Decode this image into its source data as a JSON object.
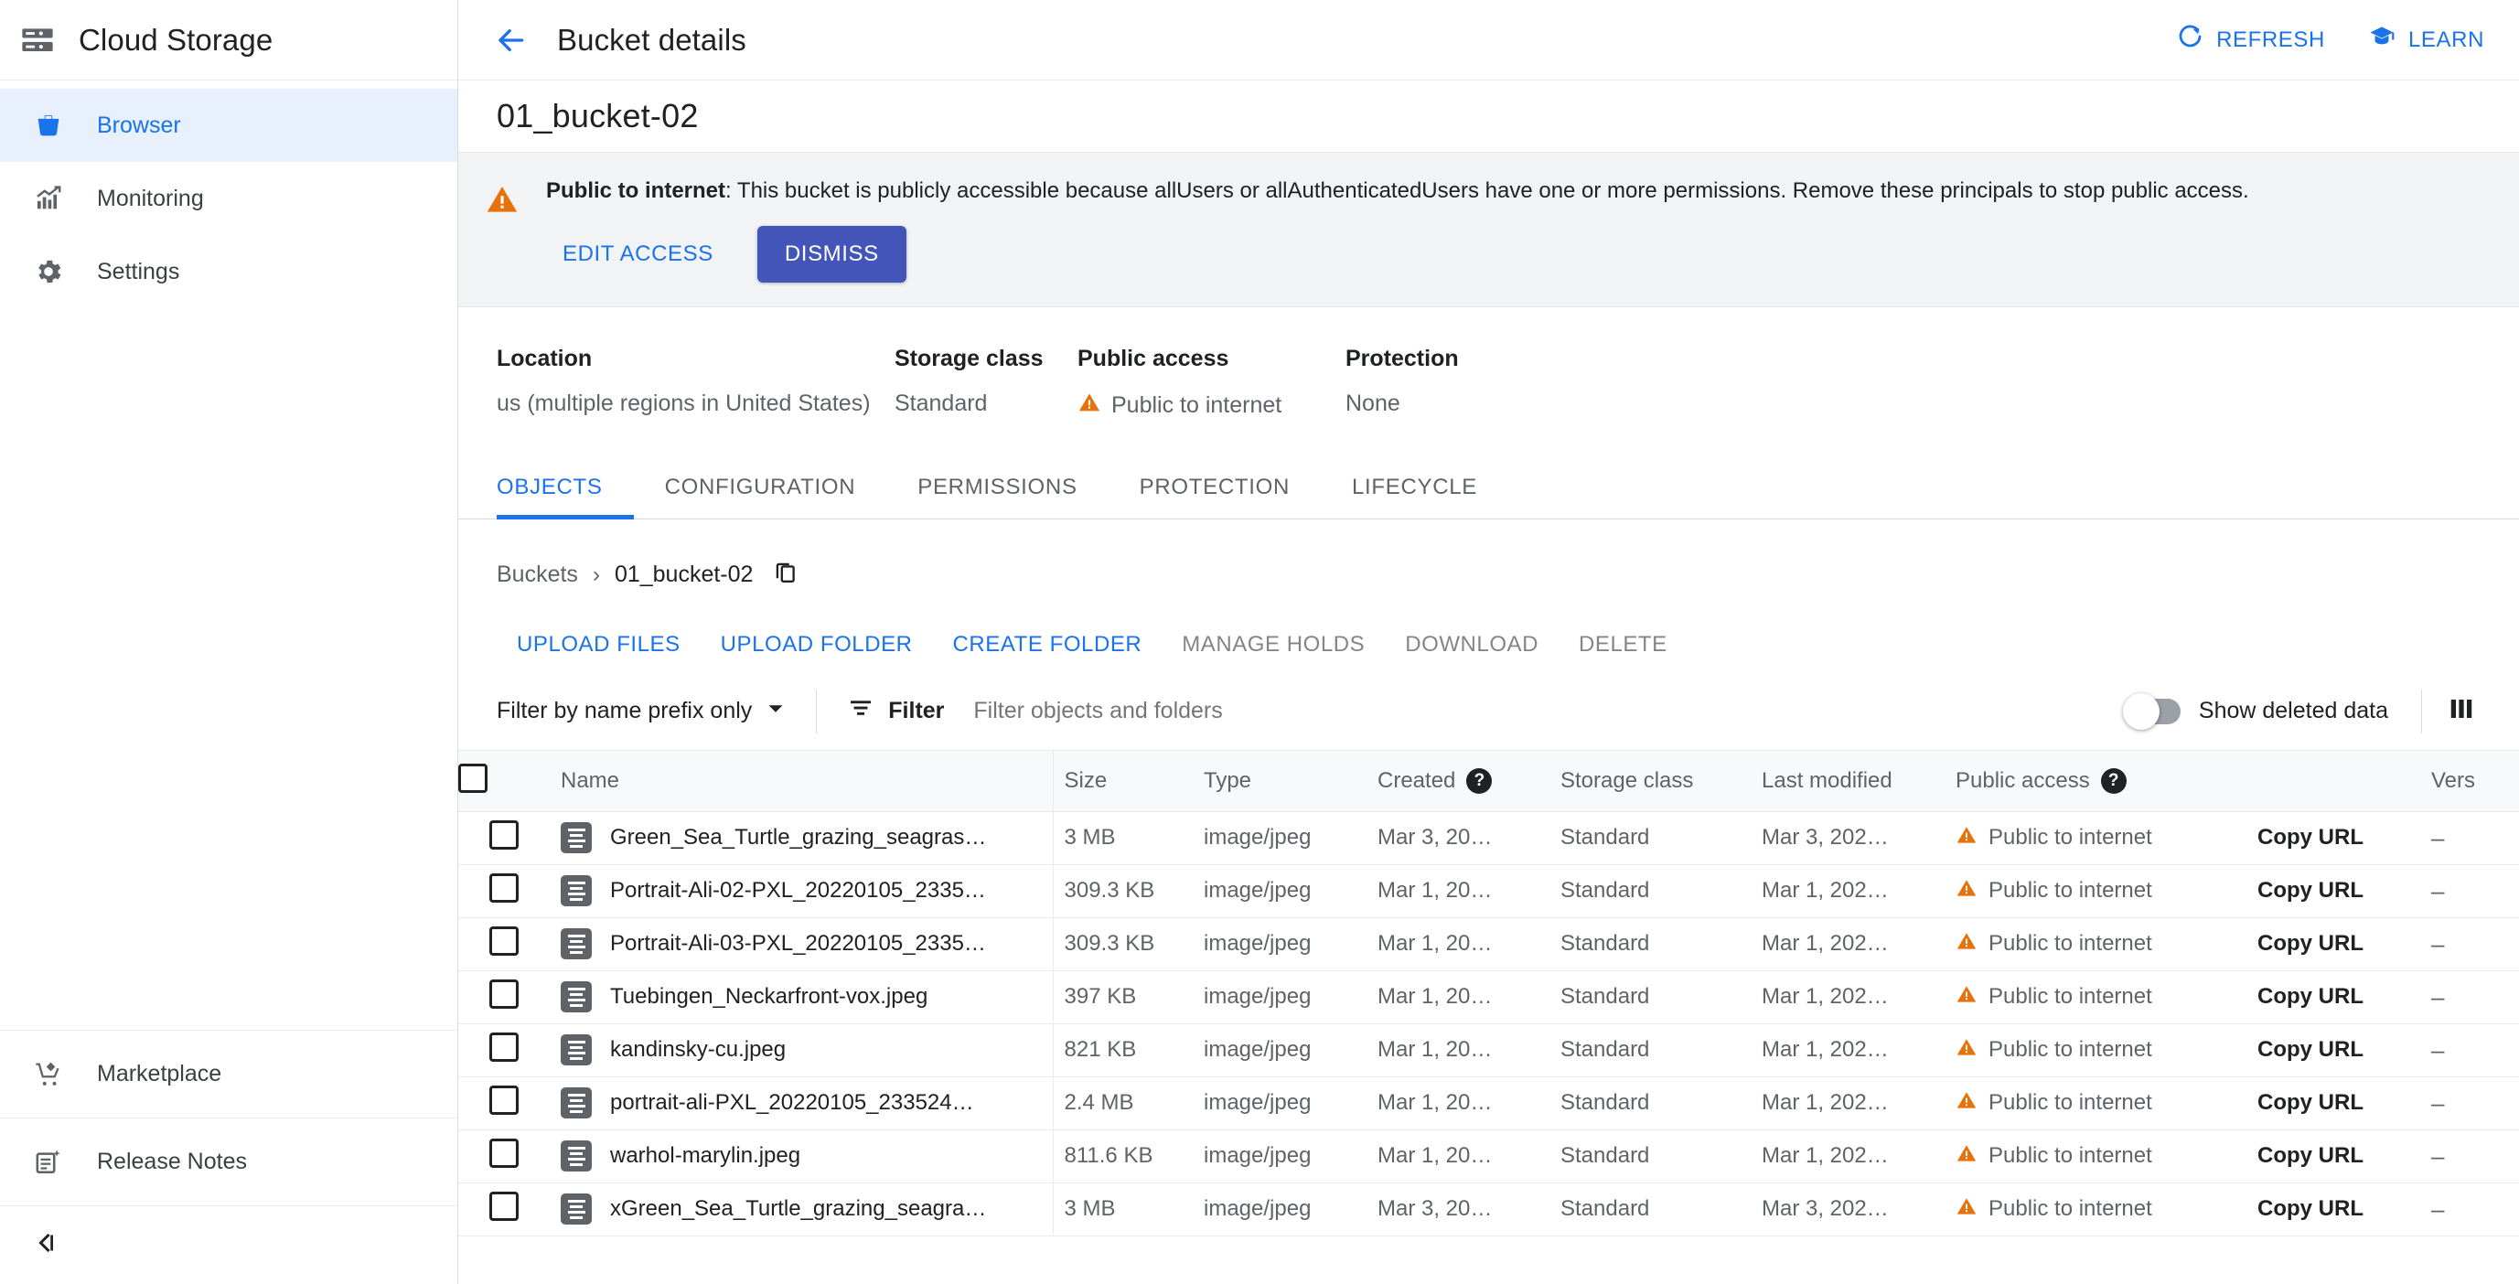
{
  "sidebar": {
    "brand": "Cloud Storage",
    "items": [
      {
        "label": "Browser",
        "icon": "bucket-icon",
        "active": true
      },
      {
        "label": "Monitoring",
        "icon": "chart-icon",
        "active": false
      },
      {
        "label": "Settings",
        "icon": "gear-icon",
        "active": false
      }
    ],
    "bottom_items": [
      {
        "label": "Marketplace",
        "icon": "cart-icon"
      },
      {
        "label": "Release Notes",
        "icon": "notes-icon"
      }
    ],
    "collapse_label": "collapse-panel"
  },
  "topbar": {
    "back_label": "back-arrow",
    "title": "Bucket details",
    "refresh_label": "REFRESH",
    "learn_label": "LEARN"
  },
  "bucket": {
    "name": "01_bucket-02"
  },
  "banner": {
    "strong": "Public to internet",
    "text": ": This bucket is publicly accessible because allUsers or allAuthenticatedUsers have one or more permissions. Remove these principals to stop public access.",
    "edit_access_label": "EDIT ACCESS",
    "dismiss_label": "DISMISS",
    "warning_color": "#e8710a"
  },
  "meta": [
    {
      "label": "Location",
      "value": "us (multiple regions in United States)",
      "warn": false
    },
    {
      "label": "Storage class",
      "value": "Standard",
      "warn": false
    },
    {
      "label": "Public access",
      "value": "Public to internet",
      "warn": true
    },
    {
      "label": "Protection",
      "value": "None",
      "warn": false
    }
  ],
  "tabs": [
    {
      "label": "OBJECTS",
      "active": true
    },
    {
      "label": "CONFIGURATION",
      "active": false
    },
    {
      "label": "PERMISSIONS",
      "active": false
    },
    {
      "label": "PROTECTION",
      "active": false
    },
    {
      "label": "LIFECYCLE",
      "active": false
    }
  ],
  "breadcrumb": {
    "root": "Buckets",
    "separator": "›",
    "current": "01_bucket-02",
    "copy_icon": "copy-icon"
  },
  "object_actions": [
    {
      "label": "UPLOAD FILES",
      "enabled": true
    },
    {
      "label": "UPLOAD FOLDER",
      "enabled": true
    },
    {
      "label": "CREATE FOLDER",
      "enabled": true
    },
    {
      "label": "MANAGE HOLDS",
      "enabled": false
    },
    {
      "label": "DOWNLOAD",
      "enabled": false
    },
    {
      "label": "DELETE",
      "enabled": false
    }
  ],
  "filterbar": {
    "prefix_select": "Filter by name prefix only",
    "filter_label": "Filter",
    "filter_placeholder": "Filter objects and folders",
    "show_deleted_label": "Show deleted data",
    "show_deleted_on": false,
    "columns_icon": "columns-icon"
  },
  "table": {
    "headers": {
      "name": "Name",
      "size": "Size",
      "type": "Type",
      "created": "Created",
      "storage_class": "Storage class",
      "last_modified": "Last modified",
      "public_access": "Public access",
      "versioning": "Vers"
    },
    "copy_url_label": "Copy URL",
    "versioning_value": "–",
    "rows": [
      {
        "name": "Green_Sea_Turtle_grazing_seagras…",
        "size": "3 MB",
        "type": "image/jpeg",
        "created": "Mar 3, 20…",
        "storage_class": "Standard",
        "last_modified": "Mar 3, 202…",
        "public_access": "Public to internet"
      },
      {
        "name": "Portrait-Ali-02-PXL_20220105_2335…",
        "size": "309.3 KB",
        "type": "image/jpeg",
        "created": "Mar 1, 20…",
        "storage_class": "Standard",
        "last_modified": "Mar 1, 202…",
        "public_access": "Public to internet"
      },
      {
        "name": "Portrait-Ali-03-PXL_20220105_2335…",
        "size": "309.3 KB",
        "type": "image/jpeg",
        "created": "Mar 1, 20…",
        "storage_class": "Standard",
        "last_modified": "Mar 1, 202…",
        "public_access": "Public to internet"
      },
      {
        "name": "Tuebingen_Neckarfront-vox.jpeg",
        "size": "397 KB",
        "type": "image/jpeg",
        "created": "Mar 1, 20…",
        "storage_class": "Standard",
        "last_modified": "Mar 1, 202…",
        "public_access": "Public to internet"
      },
      {
        "name": "kandinsky-cu.jpeg",
        "size": "821 KB",
        "type": "image/jpeg",
        "created": "Mar 1, 20…",
        "storage_class": "Standard",
        "last_modified": "Mar 1, 202…",
        "public_access": "Public to internet"
      },
      {
        "name": "portrait-ali-PXL_20220105_233524…",
        "size": "2.4 MB",
        "type": "image/jpeg",
        "created": "Mar 1, 20…",
        "storage_class": "Standard",
        "last_modified": "Mar 1, 202…",
        "public_access": "Public to internet"
      },
      {
        "name": "warhol-marylin.jpeg",
        "size": "811.6 KB",
        "type": "image/jpeg",
        "created": "Mar 1, 20…",
        "storage_class": "Standard",
        "last_modified": "Mar 1, 202…",
        "public_access": "Public to internet"
      },
      {
        "name": "xGreen_Sea_Turtle_grazing_seagra…",
        "size": "3 MB",
        "type": "image/jpeg",
        "created": "Mar 3, 20…",
        "storage_class": "Standard",
        "last_modified": "Mar 3, 202…",
        "public_access": "Public to internet"
      }
    ]
  },
  "colors": {
    "accent": "#1a73e8",
    "warning": "#e8710a",
    "dismiss_bg": "#4355b9"
  }
}
